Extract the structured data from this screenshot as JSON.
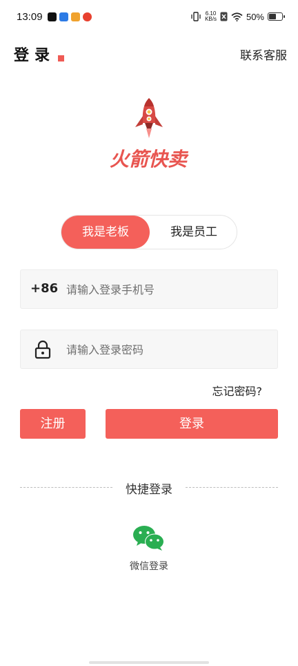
{
  "status_bar": {
    "time": "13:09",
    "app_icons": [
      "tiktok-icon",
      "app-icon-blue",
      "app-icon-map",
      "weibo-icon"
    ],
    "net_speed_value": "6.10",
    "net_speed_unit": "KB/s",
    "battery_text": "50%",
    "battery_level": 0.5
  },
  "header": {
    "title": "登录",
    "contact": "联系客服"
  },
  "brand": {
    "accent_color": "#f4605a",
    "logo_text": "火箭快卖"
  },
  "role_toggle": {
    "boss": "我是老板",
    "staff": "我是员工",
    "selected": "boss"
  },
  "phone_field": {
    "prefix": "+86",
    "placeholder": "请输入登录手机号",
    "value": ""
  },
  "password_field": {
    "placeholder": "请输入登录密码",
    "value": ""
  },
  "forgot": "忘记密码?",
  "buttons": {
    "register": "注册",
    "login": "登录"
  },
  "quick_login": {
    "title": "快捷登录",
    "wechat": "微信登录"
  }
}
